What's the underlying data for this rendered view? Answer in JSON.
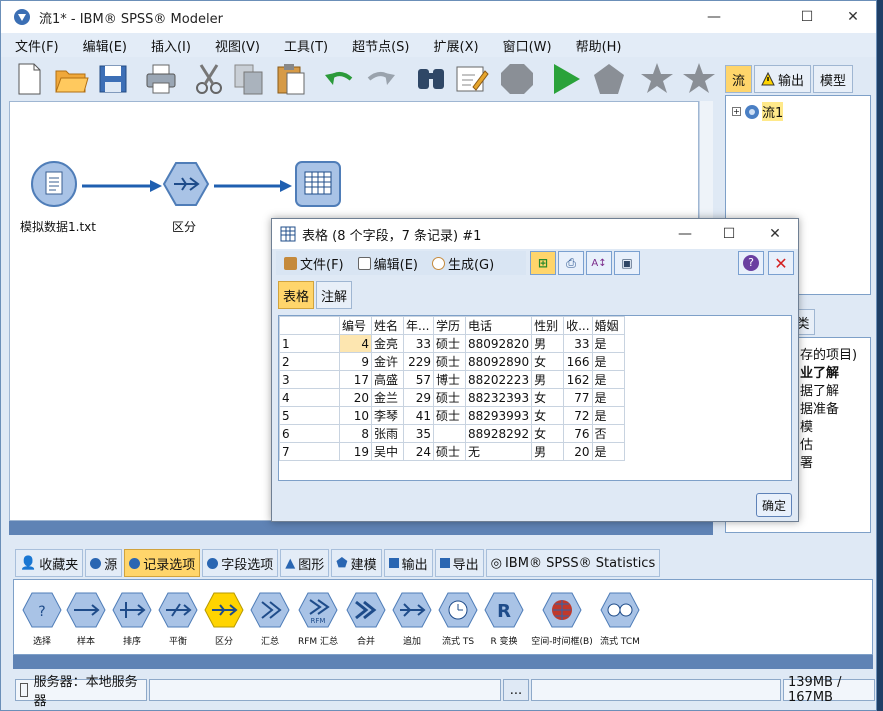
{
  "window": {
    "title": "流1* - IBM® SPSS® Modeler",
    "controls": {
      "minimize": "—",
      "maximize": "☐",
      "close": "✕"
    }
  },
  "menu": [
    "文件(F)",
    "编辑(E)",
    "插入(I)",
    "视图(V)",
    "工具(T)",
    "超节点(S)",
    "扩展(X)",
    "窗口(W)",
    "帮助(H)"
  ],
  "toolbar": [
    "new-icon",
    "open-icon",
    "save-icon",
    "print-icon",
    "cut-icon",
    "copy-icon",
    "paste-icon",
    "undo-icon",
    "redo-icon",
    "find-icon",
    "edit-icon",
    "stop-icon",
    "run-icon",
    "run-selection-icon",
    "star-icon",
    "star-options-icon"
  ],
  "canvas": {
    "nodes": [
      {
        "label": "模拟数据1.txt",
        "icon": "file-source-icon"
      },
      {
        "label": "区分",
        "icon": "distinct-icon"
      },
      {
        "label": "",
        "icon": "table-icon"
      }
    ]
  },
  "right_panel": {
    "tabs": [
      "流",
      "输出",
      "模型"
    ],
    "tree_item": "流1",
    "lower_tab": "类",
    "lower_items": [
      "存的项目)",
      "业了解",
      "据了解",
      "据准备",
      "模",
      "估",
      "署"
    ]
  },
  "dialog": {
    "title": "表格 (8 个字段，7 条记录)  #1",
    "menu": [
      "文件(F)",
      "编辑(E)",
      "生成(G)"
    ],
    "tabs": [
      "表格",
      "注解"
    ],
    "columns": [
      "",
      "编号",
      "姓名",
      "年...",
      "学历",
      "电话",
      "性别",
      "收...",
      "婚姻"
    ],
    "rows": [
      [
        "1",
        "4",
        "金亮",
        "33",
        "硕士",
        "88092820",
        "男",
        "33",
        "是"
      ],
      [
        "2",
        "9",
        "金许",
        "229",
        "硕士",
        "88092890",
        "女",
        "166",
        "是"
      ],
      [
        "3",
        "17",
        "高盛",
        "57",
        "博士",
        "88202223",
        "男",
        "162",
        "是"
      ],
      [
        "4",
        "20",
        "金兰",
        "29",
        "硕士",
        "88232393",
        "女",
        "77",
        "是"
      ],
      [
        "5",
        "10",
        "李琴",
        "41",
        "硕士",
        "88293993",
        "女",
        "72",
        "是"
      ],
      [
        "6",
        "8",
        "张雨",
        "35",
        "",
        "88928292",
        "女",
        "76",
        "否"
      ],
      [
        "7",
        "19",
        "吴中",
        "24",
        "硕士",
        "无",
        "男",
        "20",
        "是"
      ]
    ],
    "ok": "确定"
  },
  "palette": {
    "tabs": [
      "收藏夹",
      "源",
      "记录选项",
      "字段选项",
      "图形",
      "建模",
      "输出",
      "导出",
      "IBM® SPSS® Statistics"
    ],
    "active_tab": "记录选项",
    "nodes": [
      "选择",
      "样本",
      "排序",
      "平衡",
      "区分",
      "汇总",
      "RFM 汇总",
      "合并",
      "追加",
      "流式 TS",
      "R 变换",
      "空间-时间框(B)",
      "流式 TCM"
    ]
  },
  "status": {
    "server": "服务器：本地服务器",
    "ellipsis": "...",
    "memory": "139MB / 167MB"
  }
}
